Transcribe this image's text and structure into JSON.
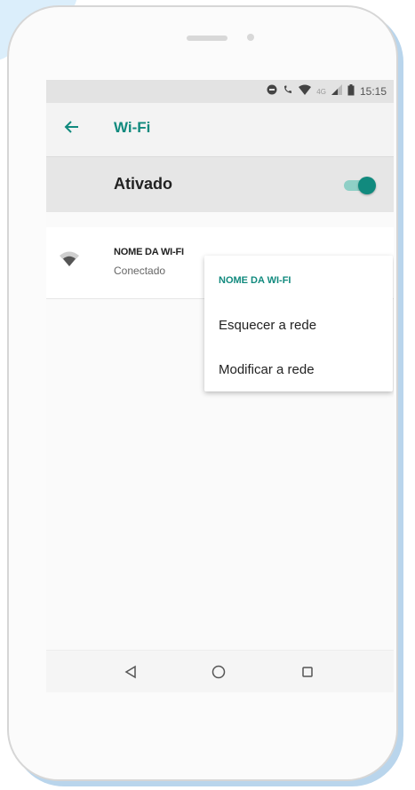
{
  "status_bar": {
    "time": "15:15",
    "icons": [
      "dnd-icon",
      "call-icon",
      "wifi-status-icon",
      "lte-icon",
      "signal-icon",
      "battery-icon"
    ],
    "lte_label": "4G"
  },
  "app_bar": {
    "title": "Wi-Fi",
    "back_icon": "arrow-left-icon"
  },
  "wifi_switch": {
    "label": "Ativado",
    "enabled": true
  },
  "network": {
    "name": "NOME DA WI-FI",
    "status": "Conectado",
    "icon": "wifi-signal-icon"
  },
  "context_menu": {
    "title": "NOME DA WI-FI",
    "items": [
      {
        "label": "Esquecer a rede"
      },
      {
        "label": "Modificar a rede"
      }
    ]
  },
  "nav_bar": {
    "buttons": [
      "back-triangle-icon",
      "home-circle-icon",
      "recent-square-icon"
    ]
  },
  "colors": {
    "accent": "#118a7e",
    "accent_light": "#8fcfc6",
    "status_bar_bg": "#e3e3e3",
    "app_bar_bg": "#f3f3f3",
    "switch_row_bg": "#e6e6e6"
  }
}
